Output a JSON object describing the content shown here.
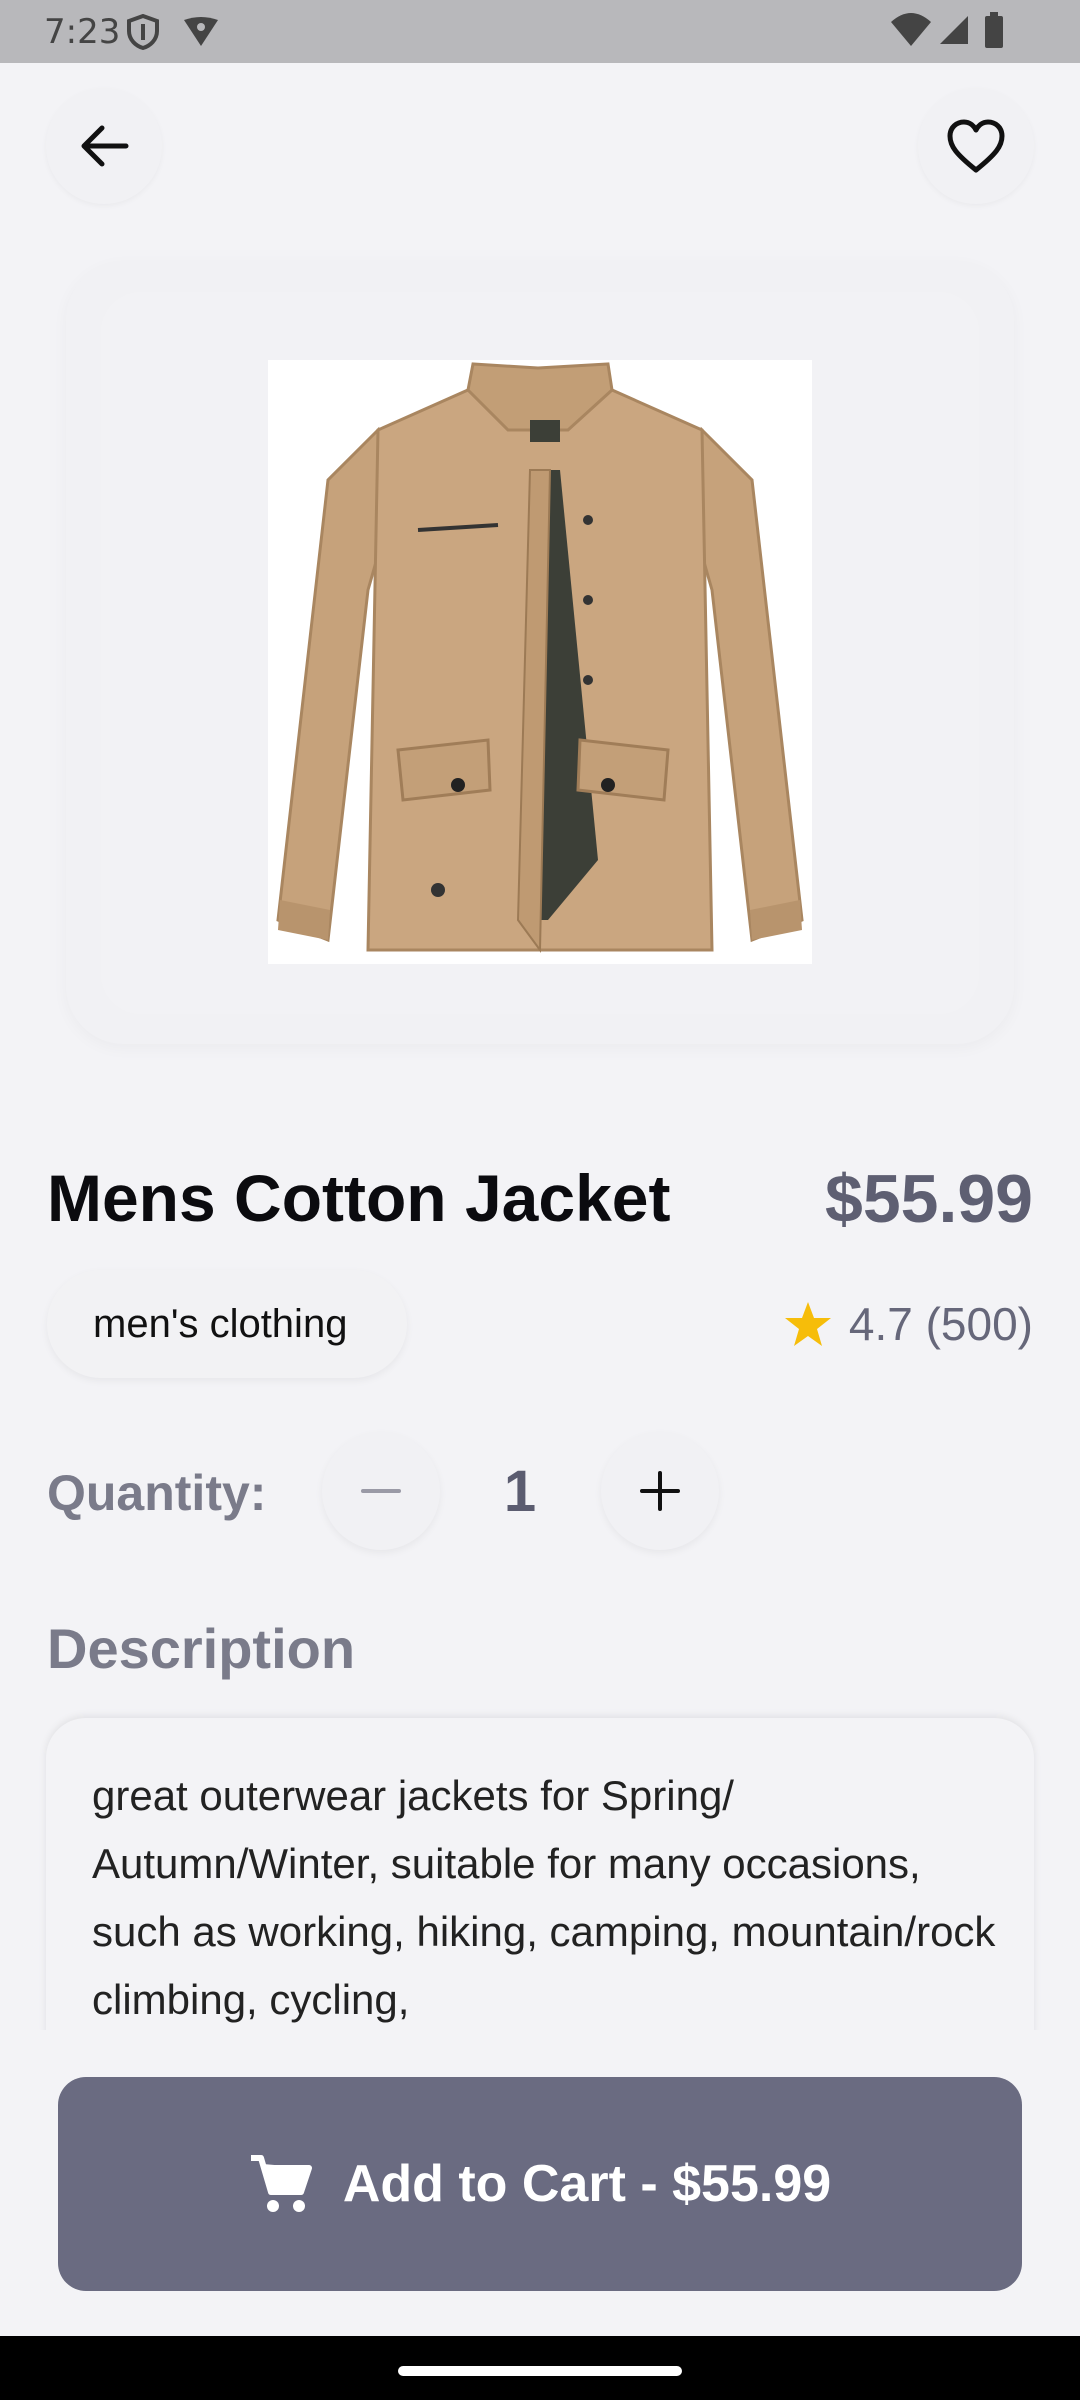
{
  "status_bar": {
    "time": "7:23"
  },
  "header": {
    "back_icon": "arrow-left-icon",
    "favorite_icon": "heart-outline-icon"
  },
  "product": {
    "title": "Mens Cotton Jacket",
    "price": "$55.99",
    "category": "men's clothing",
    "rating_text": "4.7 (500)",
    "image_alt": "Khaki cotton jacket"
  },
  "quantity": {
    "label": "Quantity:",
    "value": "1"
  },
  "description": {
    "heading": "Description",
    "text": "great outerwear jackets for Spring/ Autumn/Winter, suitable for many occasions, such as working, hiking, camping, mountain/rock climbing, cycling,"
  },
  "cart": {
    "label": "Add to Cart - $55.99"
  },
  "colors": {
    "accent": "#6a6b81",
    "star": "#f6bd0a",
    "jacket": "#c9a47d"
  }
}
